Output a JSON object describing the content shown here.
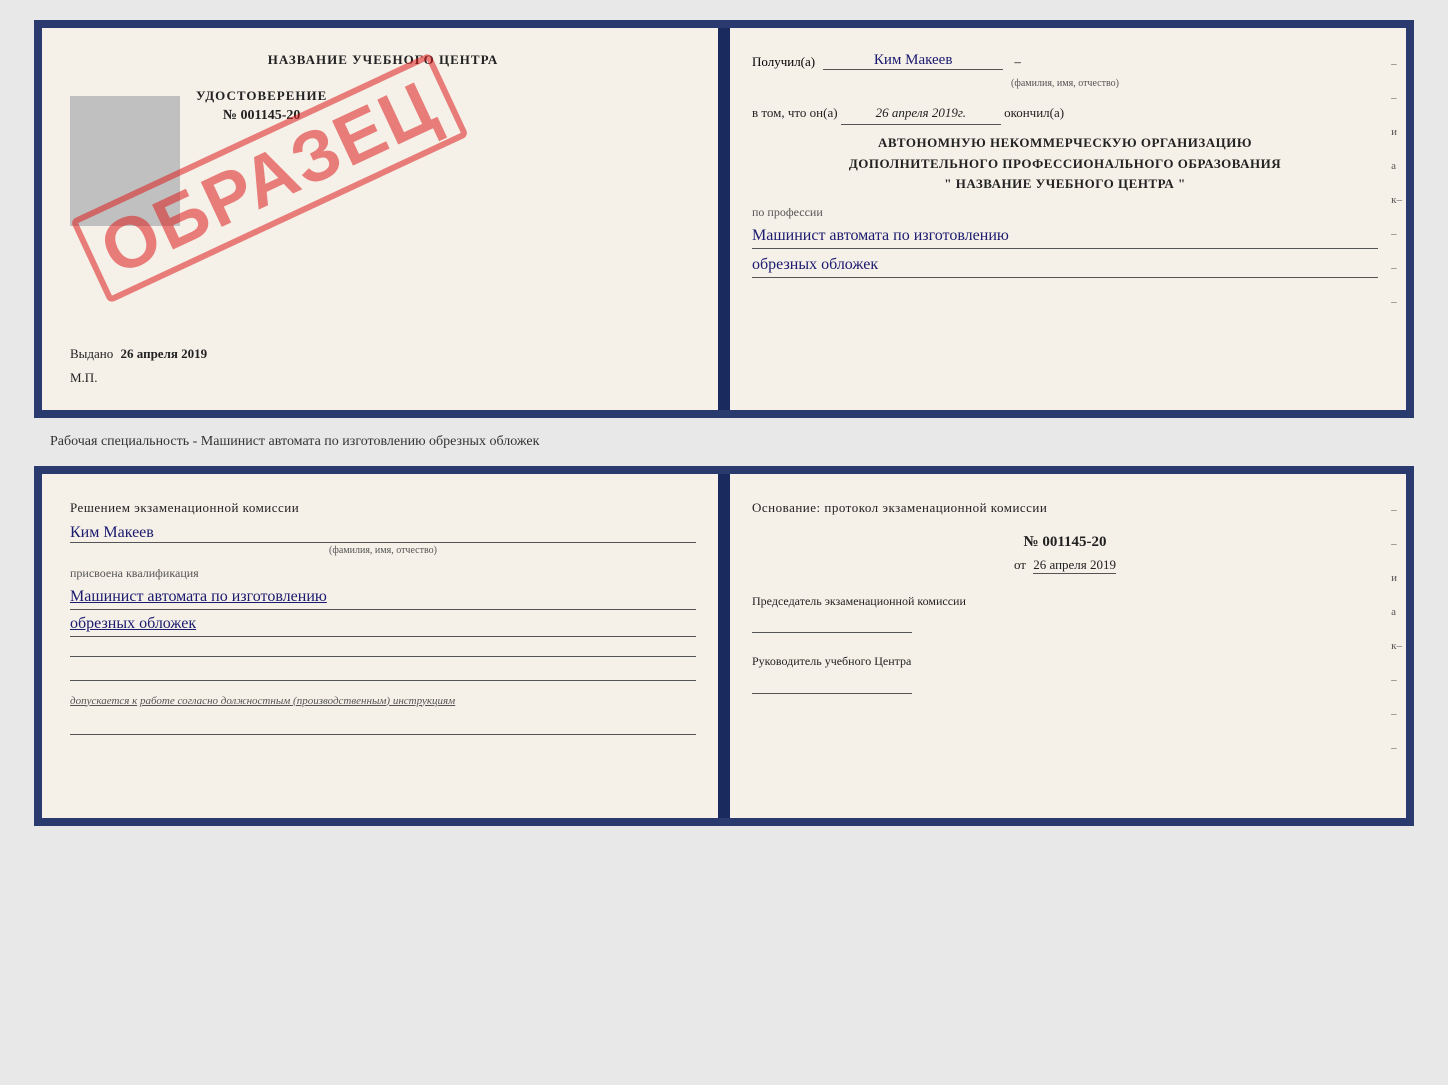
{
  "topDoc": {
    "left": {
      "header": "НАЗВАНИЕ УЧЕБНОГО ЦЕНТРА",
      "certTitle": "УДОСТОВЕРЕНИЕ",
      "certNumber": "№ 001145-20",
      "obrazec": "ОБРАЗЕЦ",
      "vydano": "Выдано",
      "vydanoDate": "26 апреля 2019",
      "mp": "М.П."
    },
    "right": {
      "poluchilLabel": "Получил(а)",
      "recipientName": "Ким Макеев",
      "fioLabel": "(фамилия, имя, отчество)",
      "vtomLabel": "в том, что он(а)",
      "date": "26 апреля 2019г.",
      "okoncilLabel": "окончил(а)",
      "orgLine1": "АВТОНОМНУЮ НЕКОММЕРЧЕСКУЮ ОРГАНИЗАЦИЮ",
      "orgLine2": "ДОПОЛНИТЕЛЬНОГО ПРОФЕССИОНАЛЬНОГО ОБРАЗОВАНИЯ",
      "orgLine3": "\"   НАЗВАНИЕ УЧЕБНОГО ЦЕНТРА   \"",
      "poProf": "по профессии",
      "profession1": "Машинист автомата по изготовлению",
      "profession2": "обрезных обложек",
      "sideChars": [
        "–",
        "–",
        "и",
        "а",
        "к–",
        "–",
        "–",
        "–",
        "–"
      ]
    }
  },
  "caption": "Рабочая специальность - Машинист автомата по изготовлению обрезных обложек",
  "bottomDoc": {
    "left": {
      "title": "Решением экзаменационной комиссии",
      "name": "Ким Макеев",
      "fioLabel": "(фамилия, имя, отчество)",
      "prisvoena": "присвоена квалификация",
      "profession1": "Машинист автомата по изготовлению",
      "profession2": "обрезных обложек",
      "dopLabel": "допускается к",
      "dopText": "работе согласно должностным (производственным) инструкциям"
    },
    "right": {
      "osnTitle": "Основание: протокол экзаменационной комиссии",
      "number": "№ 001145-20",
      "otLabel": "от",
      "date": "26 апреля 2019",
      "predsLabel": "Председатель экзаменационной комиссии",
      "rukovLabel": "Руководитель учебного Центра",
      "sideChars": [
        "–",
        "–",
        "и",
        "а",
        "к–",
        "–",
        "–",
        "–"
      ]
    }
  }
}
